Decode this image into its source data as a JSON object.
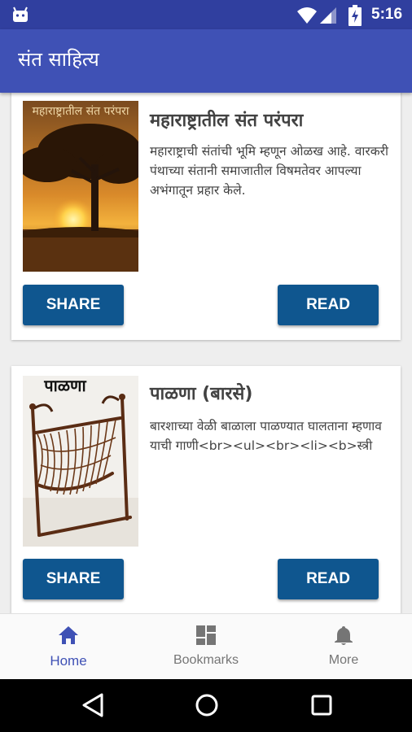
{
  "status_bar": {
    "time": "5:16"
  },
  "app_bar": {
    "title": "संत साहित्य"
  },
  "cards": [
    {
      "thumb_caption": "महाराष्ट्रातील संत परंपरा",
      "title": "महाराष्ट्रातील संत परंपरा",
      "description": "महाराष्ट्राची संतांची भूमि म्हणून ओळख आहे. वारकरी पंथाच्या संतानी समाजातील विषमतेवर आपल्या अभंगातून प्रहार केले.",
      "share_label": "SHARE",
      "read_label": "READ"
    },
    {
      "thumb_caption": "पाळणा",
      "title": "पाळणा (बारसे)",
      "description": "बारशाच्या वेळी बाळाला पाळण्यात घालताना म्हणावयाची गाणी<br><ul><br><li><b>स्त्री",
      "share_label": "SHARE",
      "read_label": "READ"
    }
  ],
  "bottom_nav": [
    {
      "label": "Home",
      "icon": "home-icon",
      "active": true
    },
    {
      "label": "Bookmarks",
      "icon": "dashboard-icon",
      "active": false
    },
    {
      "label": "More",
      "icon": "bell-icon",
      "active": false
    }
  ],
  "colors": {
    "status_bar": "#303f9f",
    "app_bar": "#3f51b5",
    "button": "#0f568f",
    "nav_active": "#3f51b5",
    "nav_inactive": "#757575"
  }
}
